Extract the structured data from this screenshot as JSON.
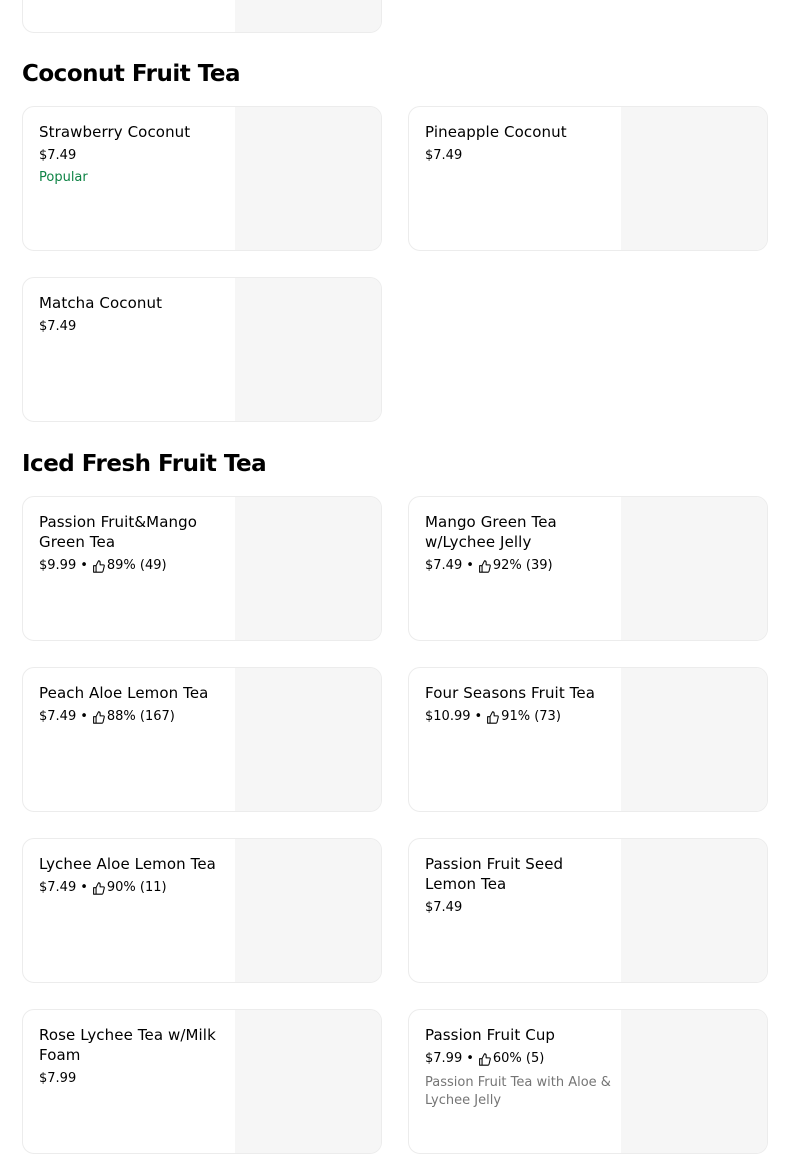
{
  "sections": [
    {
      "title": "Coconut Fruit Tea",
      "items": [
        {
          "name": "Strawberry Coconut",
          "price": "$7.49",
          "badge": "Popular"
        },
        {
          "name": "Pineapple Coconut",
          "price": "$7.49"
        },
        {
          "name": "Matcha Coconut",
          "price": "$7.49"
        }
      ]
    },
    {
      "title": "Iced Fresh Fruit Tea",
      "items": [
        {
          "name": "Passion Fruit&Mango Green Tea",
          "price": "$9.99",
          "rating": "89% (49)"
        },
        {
          "name": "Mango Green Tea w/Lychee Jelly",
          "price": "$7.49",
          "rating": "92% (39)"
        },
        {
          "name": "Peach Aloe Lemon Tea",
          "price": "$7.49",
          "rating": "88% (167)"
        },
        {
          "name": "Four Seasons Fruit Tea",
          "price": "$10.99",
          "rating": "91% (73)"
        },
        {
          "name": "Lychee Aloe Lemon Tea",
          "price": "$7.49",
          "rating": "90% (11)"
        },
        {
          "name": "Passion Fruit Seed Lemon Tea",
          "price": "$7.49"
        },
        {
          "name": "Rose Lychee Tea w/Milk Foam",
          "price": "$7.99"
        },
        {
          "name": "Passion Fruit Cup",
          "price": "$7.99",
          "rating": "60% (5)",
          "description": "Passion Fruit Tea with Aloe & Lychee Jelly"
        }
      ]
    }
  ],
  "separator": "•",
  "icons": {
    "rating": "thumbs-up-icon"
  },
  "colors": {
    "popular": "#0e8345",
    "image_placeholder": "#f6f6f6"
  }
}
